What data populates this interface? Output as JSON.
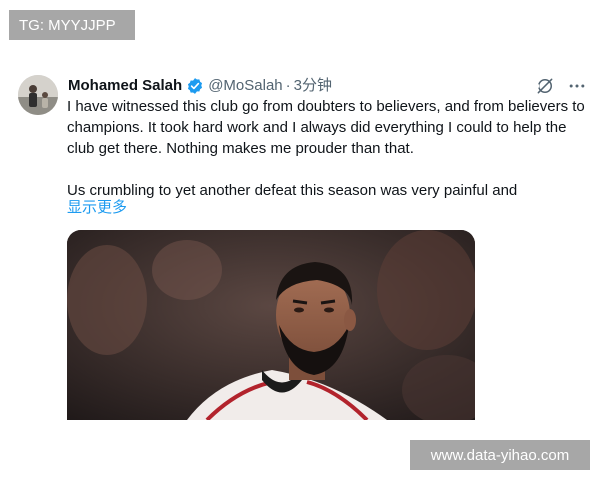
{
  "overlays": {
    "top_left_label": "TG: MYYJJPP",
    "bottom_right_label": "www.data-yihao.com"
  },
  "tweet": {
    "author_name": "Mohamed Salah",
    "verified": true,
    "handle": "@MoSalah",
    "separator": "·",
    "time_ago": "3分钟",
    "paragraphs": [
      "I have witnessed this club go from doubters to believers, and from believers to champions. It took hard work and I always did everything I could to help the club get there. Nothing makes me prouder than that.",
      "Us crumbling to yet another defeat this season was very painful and"
    ],
    "show_more_label": "显示更多",
    "icons": {
      "grok": "grok-icon",
      "more": "more-options-icon",
      "verified": "verified-badge-icon"
    },
    "colors": {
      "verified": "#1d9bf0",
      "link": "#1d9bf0",
      "secondary_text": "#536471"
    }
  }
}
